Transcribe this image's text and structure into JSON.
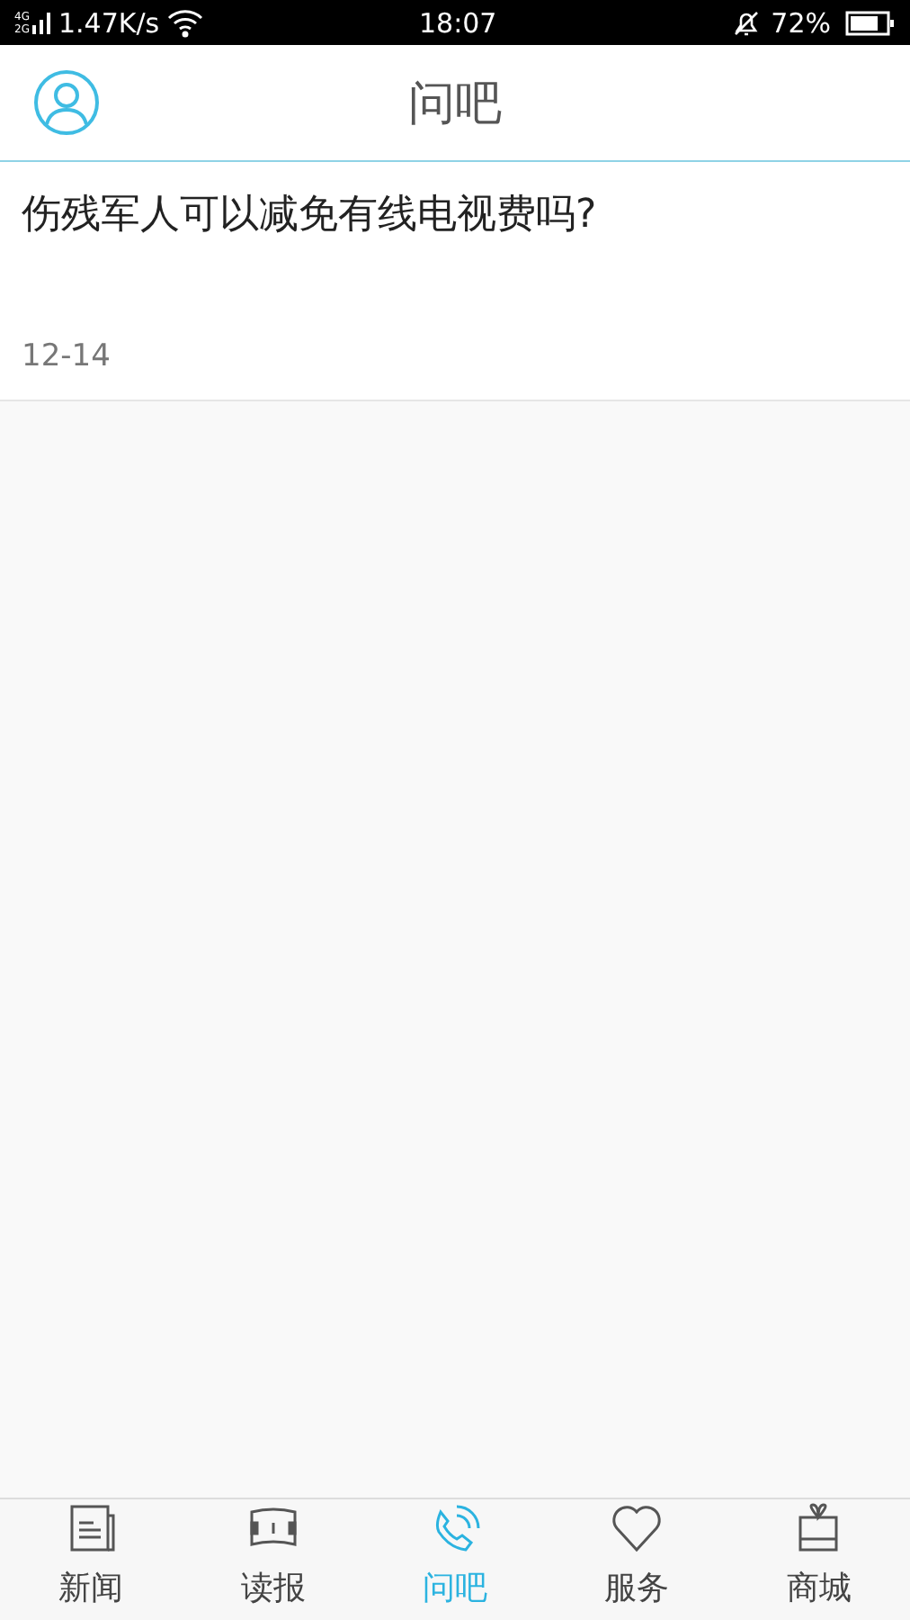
{
  "status_bar": {
    "network": [
      "4G",
      "2G"
    ],
    "speed": "1.47K/s",
    "time": "18:07",
    "battery": "72%"
  },
  "header": {
    "title": "问吧"
  },
  "questions": [
    {
      "title": "伤残军人可以减免有线电视费吗?",
      "date": "12-14"
    }
  ],
  "tabs": [
    {
      "label": "新闻",
      "kind": "news",
      "selected": false
    },
    {
      "label": "读报",
      "kind": "paper",
      "selected": false
    },
    {
      "label": "问吧",
      "kind": "ask",
      "selected": true
    },
    {
      "label": "服务",
      "kind": "service",
      "selected": false
    },
    {
      "label": "商城",
      "kind": "shop",
      "selected": false
    }
  ]
}
